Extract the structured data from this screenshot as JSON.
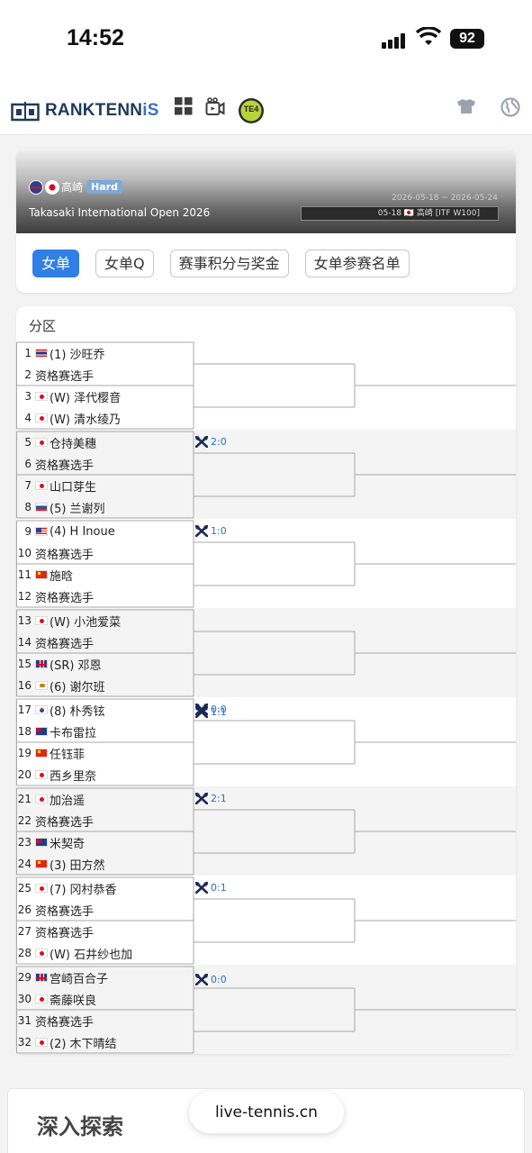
{
  "status_bar": {
    "time": "14:52",
    "battery": "92"
  },
  "header": {
    "brand_main": "RANKTENN",
    "brand_accent": "iS",
    "te4": "TE4"
  },
  "tournament": {
    "location": "高崎",
    "surface": "Hard",
    "dates": "2026-05-18 ~ 2026-05-24",
    "name": "Takasaki International Open 2026",
    "week": "05-18 🇯🇵 高崎 [ITF W100]"
  },
  "tabs": [
    {
      "label": "女单",
      "active": true
    },
    {
      "label": "女单Q",
      "active": false
    },
    {
      "label": "赛事积分与奖金",
      "active": false
    },
    {
      "label": "女单参赛名单",
      "active": false
    }
  ],
  "draw": {
    "title": "分区",
    "players": [
      {
        "num": "1",
        "flag": "th",
        "name": "(1) 沙旺乔"
      },
      {
        "num": "2",
        "flag": "",
        "name": "资格赛选手"
      },
      {
        "num": "3",
        "flag": "jp",
        "name": "(W) 泽代樱音"
      },
      {
        "num": "4",
        "flag": "jp",
        "name": "(W) 清水绫乃"
      },
      {
        "num": "5",
        "flag": "jp",
        "name": "仓持美穗"
      },
      {
        "num": "6",
        "flag": "",
        "name": "资格赛选手"
      },
      {
        "num": "7",
        "flag": "jp",
        "name": "山口芽生"
      },
      {
        "num": "8",
        "flag": "ru",
        "name": "(5) 兰谢列"
      },
      {
        "num": "9",
        "flag": "us",
        "name": "(4) H Inoue"
      },
      {
        "num": "10",
        "flag": "",
        "name": "资格赛选手"
      },
      {
        "num": "11",
        "flag": "cn",
        "name": "施晗"
      },
      {
        "num": "12",
        "flag": "",
        "name": "资格赛选手"
      },
      {
        "num": "13",
        "flag": "jp",
        "name": "(W) 小池爱菜"
      },
      {
        "num": "14",
        "flag": "",
        "name": "资格赛选手"
      },
      {
        "num": "15",
        "flag": "gb",
        "name": "(SR) 邓恩"
      },
      {
        "num": "16",
        "flag": "cy",
        "name": "(6) 谢尔班"
      },
      {
        "num": "17",
        "flag": "kr",
        "name": "(8) 朴秀铉"
      },
      {
        "num": "18",
        "flag": "au",
        "name": "卡布雷拉"
      },
      {
        "num": "19",
        "flag": "cn",
        "name": "任钰菲"
      },
      {
        "num": "20",
        "flag": "jp",
        "name": "西乡里奈"
      },
      {
        "num": "21",
        "flag": "jp",
        "name": "加治遥"
      },
      {
        "num": "22",
        "flag": "",
        "name": "资格赛选手"
      },
      {
        "num": "23",
        "flag": "au",
        "name": "米契奇"
      },
      {
        "num": "24",
        "flag": "cn",
        "name": "(3) 田方然"
      },
      {
        "num": "25",
        "flag": "jp",
        "name": "(7) 冈村恭香"
      },
      {
        "num": "26",
        "flag": "",
        "name": "资格赛选手"
      },
      {
        "num": "27",
        "flag": "",
        "name": "资格赛选手"
      },
      {
        "num": "28",
        "flag": "jp",
        "name": "(W) 石井纱也加"
      },
      {
        "num": "29",
        "flag": "gb",
        "name": "宫崎百合子"
      },
      {
        "num": "30",
        "flag": "jp",
        "name": "斋藤咲良"
      },
      {
        "num": "31",
        "flag": "",
        "name": "资格赛选手"
      },
      {
        "num": "32",
        "flag": "jp",
        "name": "(2) 木下晴结"
      }
    ],
    "scores": [
      {
        "match": 2,
        "text": "2:0",
        "pos": "lower"
      },
      {
        "match": 4,
        "text": "1:0",
        "pos": "lower"
      },
      {
        "match": 8,
        "text": "0:0",
        "pos": "lower"
      },
      {
        "match": 9,
        "text": "1:1",
        "pos": "upper"
      },
      {
        "match": 10,
        "text": "2:1",
        "pos": "lower"
      },
      {
        "match": 12,
        "text": "0:1",
        "pos": "lower"
      },
      {
        "match": 15,
        "text": "0:0",
        "pos": "upper"
      }
    ]
  },
  "footer": {
    "explore_title": "深入探索",
    "site": "live-tennis.cn"
  }
}
